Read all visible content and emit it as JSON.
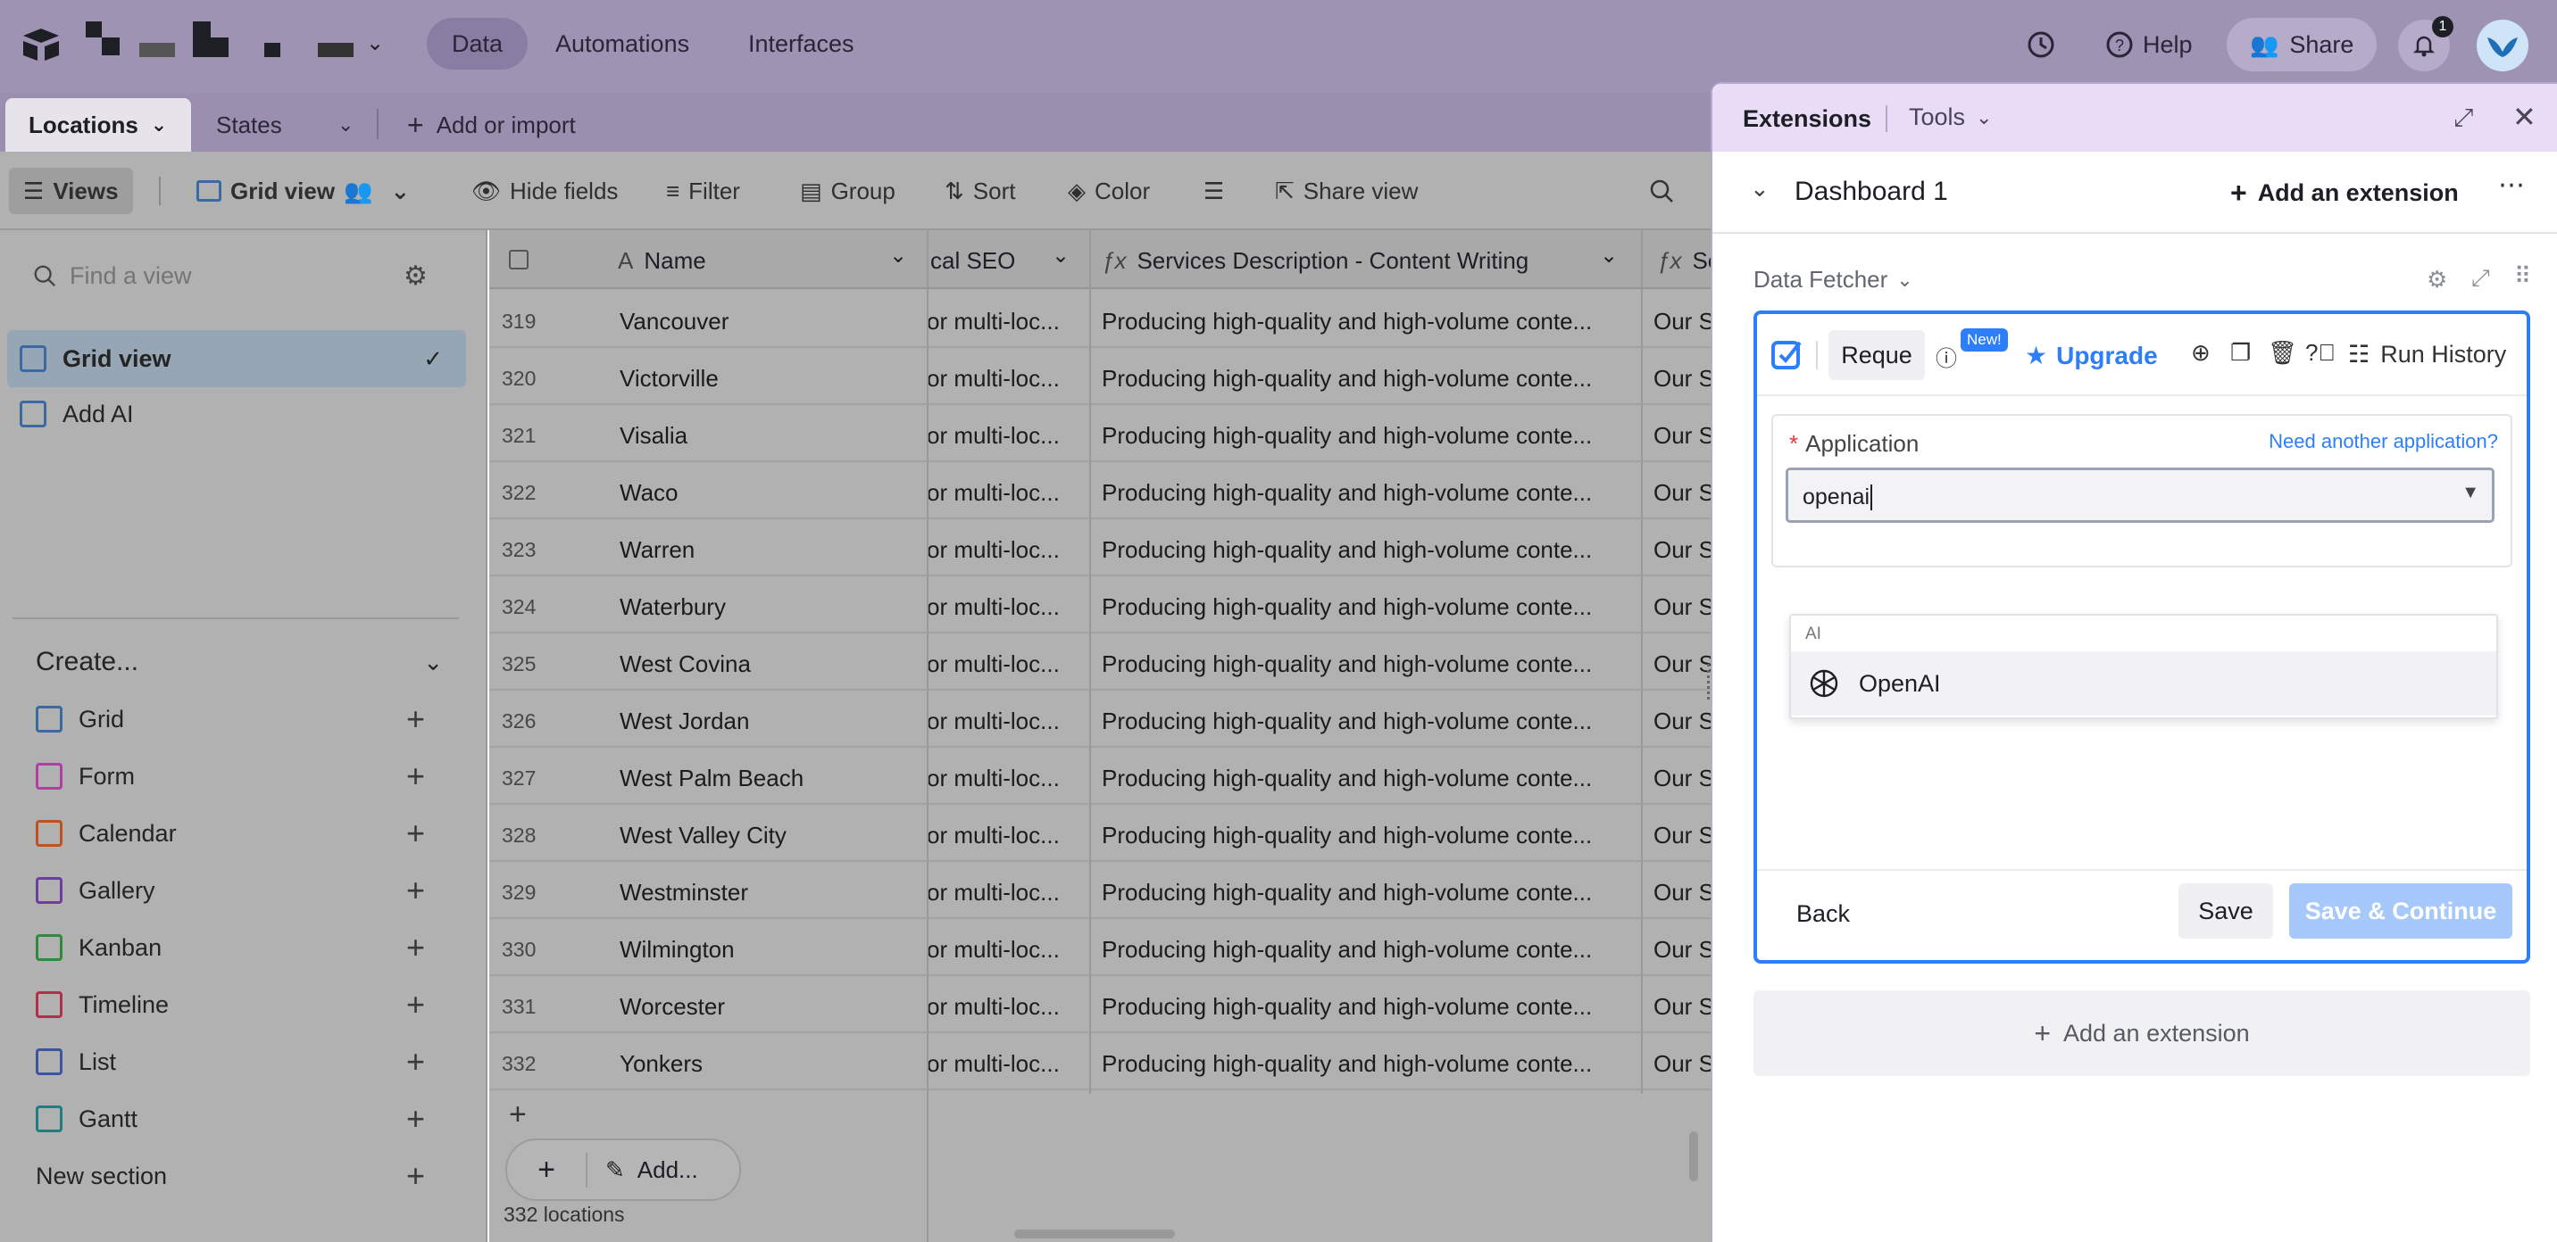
{
  "topbar": {
    "nav": [
      "Data",
      "Automations",
      "Interfaces"
    ],
    "help": "Help",
    "share": "Share",
    "notifications_count": "1"
  },
  "tabs": {
    "locations": "Locations",
    "states": "States",
    "add_import": "Add or import"
  },
  "toolbar": {
    "views": "Views",
    "grid_view": "Grid view",
    "hide_fields": "Hide fields",
    "filter": "Filter",
    "group": "Group",
    "sort": "Sort",
    "color": "Color",
    "share_view": "Share view"
  },
  "sidebar": {
    "find_placeholder": "Find a view",
    "views": [
      "Grid view",
      "Add AI"
    ],
    "create_label": "Create...",
    "create_items": [
      "Grid",
      "Form",
      "Calendar",
      "Gallery",
      "Kanban",
      "Timeline",
      "List",
      "Gantt"
    ],
    "new_section": "New section"
  },
  "grid": {
    "headers": {
      "name": "Name",
      "seo": "cal SEO",
      "services": "Services Description - Content Writing",
      "next": "Se"
    },
    "rows": [
      {
        "num": "319",
        "name": "Vancouver"
      },
      {
        "num": "320",
        "name": "Victorville"
      },
      {
        "num": "321",
        "name": "Visalia"
      },
      {
        "num": "322",
        "name": "Waco"
      },
      {
        "num": "323",
        "name": "Warren"
      },
      {
        "num": "324",
        "name": "Waterbury"
      },
      {
        "num": "325",
        "name": "West Covina"
      },
      {
        "num": "326",
        "name": "West Jordan"
      },
      {
        "num": "327",
        "name": "West Palm Beach"
      },
      {
        "num": "328",
        "name": "West Valley City"
      },
      {
        "num": "329",
        "name": "Westminster"
      },
      {
        "num": "330",
        "name": "Wilmington"
      },
      {
        "num": "331",
        "name": "Worcester"
      },
      {
        "num": "332",
        "name": "Yonkers"
      }
    ],
    "seo_cell": "or multi-loc...",
    "services_cell": "Producing high-quality and high-volume conte...",
    "next_cell": "Our S",
    "add_label": "Add...",
    "record_count": "332 locations"
  },
  "panel": {
    "extensions": "Extensions",
    "tools": "Tools",
    "dashboard": "Dashboard 1",
    "add_extension": "Add an extension",
    "extension_name": "Data Fetcher",
    "reque": "Reque",
    "new_badge": "New!",
    "upgrade": "Upgrade",
    "run_history": "Run History",
    "application_label": "Application",
    "required_mark": "*",
    "need_another": "Need another application?",
    "app_input_value": "openai",
    "dropdown_group": "AI",
    "dropdown_option": "OpenAI",
    "back": "Back",
    "save": "Save",
    "save_continue": "Save & Continue",
    "add_extension_bottom": "Add an extension"
  },
  "colors": {
    "accent_blue": "#2d7ff9",
    "panel_header": "#e8dcf7",
    "topbar": "#9f93b3"
  }
}
